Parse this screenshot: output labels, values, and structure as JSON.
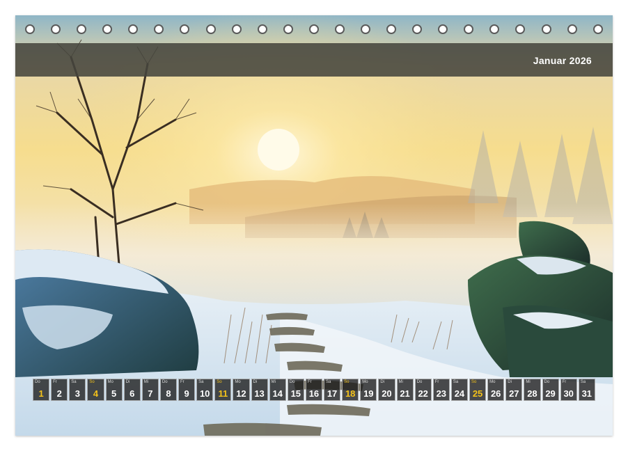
{
  "calendar": {
    "title": "Januar 2026",
    "days": [
      {
        "wd": "Do",
        "num": "1",
        "sun": false,
        "holiday": true
      },
      {
        "wd": "Fr",
        "num": "2",
        "sun": false,
        "holiday": false
      },
      {
        "wd": "Sa",
        "num": "3",
        "sun": false,
        "holiday": false
      },
      {
        "wd": "So",
        "num": "4",
        "sun": true,
        "holiday": false
      },
      {
        "wd": "Mo",
        "num": "5",
        "sun": false,
        "holiday": false
      },
      {
        "wd": "Di",
        "num": "6",
        "sun": false,
        "holiday": false
      },
      {
        "wd": "Mi",
        "num": "7",
        "sun": false,
        "holiday": false
      },
      {
        "wd": "Do",
        "num": "8",
        "sun": false,
        "holiday": false
      },
      {
        "wd": "Fr",
        "num": "9",
        "sun": false,
        "holiday": false
      },
      {
        "wd": "Sa",
        "num": "10",
        "sun": false,
        "holiday": false
      },
      {
        "wd": "So",
        "num": "11",
        "sun": true,
        "holiday": false
      },
      {
        "wd": "Mo",
        "num": "12",
        "sun": false,
        "holiday": false
      },
      {
        "wd": "Di",
        "num": "13",
        "sun": false,
        "holiday": false
      },
      {
        "wd": "Mi",
        "num": "14",
        "sun": false,
        "holiday": false
      },
      {
        "wd": "Do",
        "num": "15",
        "sun": false,
        "holiday": false
      },
      {
        "wd": "Fr",
        "num": "16",
        "sun": false,
        "holiday": false
      },
      {
        "wd": "Sa",
        "num": "17",
        "sun": false,
        "holiday": false
      },
      {
        "wd": "So",
        "num": "18",
        "sun": true,
        "holiday": false
      },
      {
        "wd": "Mo",
        "num": "19",
        "sun": false,
        "holiday": false
      },
      {
        "wd": "Di",
        "num": "20",
        "sun": false,
        "holiday": false
      },
      {
        "wd": "Mi",
        "num": "21",
        "sun": false,
        "holiday": false
      },
      {
        "wd": "Do",
        "num": "22",
        "sun": false,
        "holiday": false
      },
      {
        "wd": "Fr",
        "num": "23",
        "sun": false,
        "holiday": false
      },
      {
        "wd": "Sa",
        "num": "24",
        "sun": false,
        "holiday": false
      },
      {
        "wd": "So",
        "num": "25",
        "sun": true,
        "holiday": false
      },
      {
        "wd": "Mo",
        "num": "26",
        "sun": false,
        "holiday": false
      },
      {
        "wd": "Di",
        "num": "27",
        "sun": false,
        "holiday": false
      },
      {
        "wd": "Mi",
        "num": "28",
        "sun": false,
        "holiday": false
      },
      {
        "wd": "Do",
        "num": "29",
        "sun": false,
        "holiday": false
      },
      {
        "wd": "Fr",
        "num": "30",
        "sun": false,
        "holiday": false
      },
      {
        "wd": "Sa",
        "num": "31",
        "sun": false,
        "holiday": false
      }
    ]
  },
  "binding": {
    "ring_count": 23
  },
  "colors": {
    "highlight": "#f4c21a",
    "band": "#46463e"
  },
  "photo": {
    "icon": "winter-landscape-photo"
  }
}
